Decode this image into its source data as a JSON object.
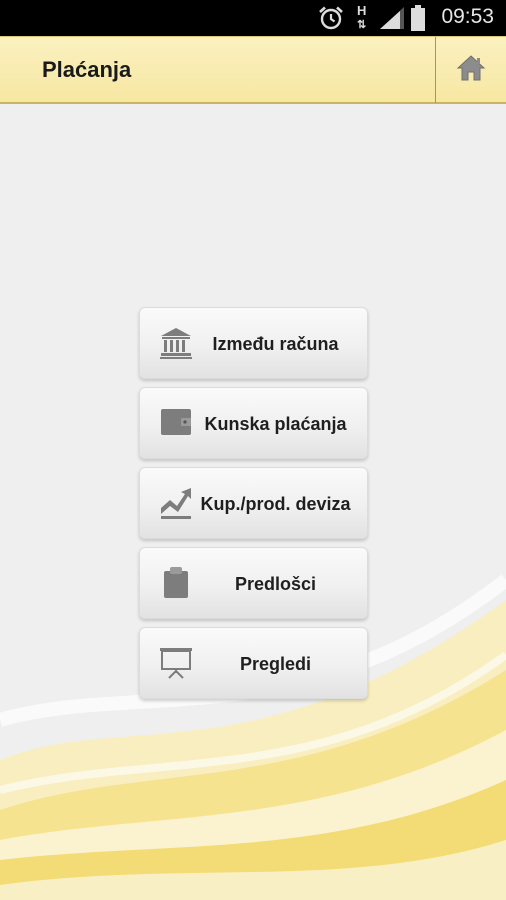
{
  "status_bar": {
    "time": "09:53",
    "network_label": "H",
    "icons": [
      "alarm-icon",
      "network-h-icon",
      "signal-icon",
      "battery-icon"
    ]
  },
  "header": {
    "title": "Plaćanja",
    "home_icon": "home-icon"
  },
  "menu": {
    "items": [
      {
        "label": "Između računa",
        "icon": "bank-icon"
      },
      {
        "label": "Kunska plaćanja",
        "icon": "wallet-icon"
      },
      {
        "label": "Kup./prod. deviza",
        "icon": "chart-trend-icon"
      },
      {
        "label": "Predlošci",
        "icon": "clipboard-icon"
      },
      {
        "label": "Pregledi",
        "icon": "presentation-icon"
      }
    ]
  },
  "colors": {
    "header_bg": "#f7e7a2",
    "background": "#efefef",
    "wave_yellow": "#f3dc75"
  }
}
